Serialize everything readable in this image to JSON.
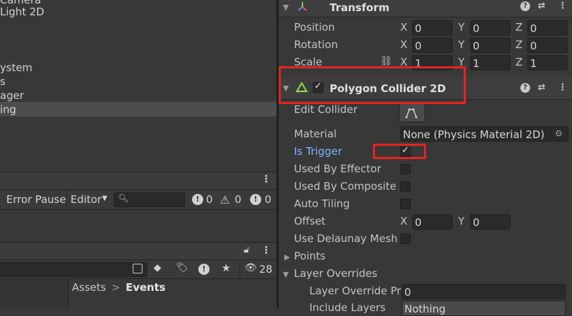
{
  "hierarchy": {
    "items": [
      "Camera",
      "Light 2D",
      "ystem",
      "s",
      "ager",
      "ing"
    ],
    "selected_index": 5
  },
  "console_toolbar": {
    "error_pause": "Error Pause",
    "editor": "Editor",
    "editor_arrow": "▼",
    "search_placeholder": "",
    "error_count": "0",
    "warning_count": "0",
    "info_count": "0"
  },
  "project_panel": {
    "breadcrumb_root": "Assets",
    "breadcrumb_sep": ">",
    "breadcrumb_current": "Events",
    "hidden_count": "28"
  },
  "transform": {
    "title": "Transform",
    "position_label": "Position",
    "rotation_label": "Rotation",
    "scale_label": "Scale",
    "position": {
      "x": "0",
      "y": "0",
      "z": "0"
    },
    "rotation": {
      "x": "0",
      "y": "0",
      "z": "0"
    },
    "scale": {
      "x": "1",
      "y": "1",
      "z": "1"
    },
    "axis_x": "X",
    "axis_y": "Y",
    "axis_z": "Z"
  },
  "polygon_collider": {
    "title": "Polygon Collider 2D",
    "enabled": true,
    "edit_collider_label": "Edit Collider",
    "material_label": "Material",
    "material_value": "None (Physics Material 2D)",
    "is_trigger_label": "Is Trigger",
    "is_trigger": true,
    "used_by_effector_label": "Used By Effector",
    "used_by_composite_label": "Used By Composite",
    "auto_tiling_label": "Auto Tiling",
    "offset_label": "Offset",
    "offset": {
      "x": "0",
      "y": "0"
    },
    "use_delaunay_label": "Use Delaunay Mesh",
    "points_label": "Points",
    "layer_overrides_label": "Layer Overrides",
    "layer_override_priority_label": "Layer Override Pri",
    "layer_override_priority": "0",
    "include_layers_label": "Include Layers",
    "include_layers_value": "Nothing"
  },
  "colors": {
    "highlight": "#e8231f",
    "label_blue": "#7cb6ff",
    "background": "#383838"
  }
}
